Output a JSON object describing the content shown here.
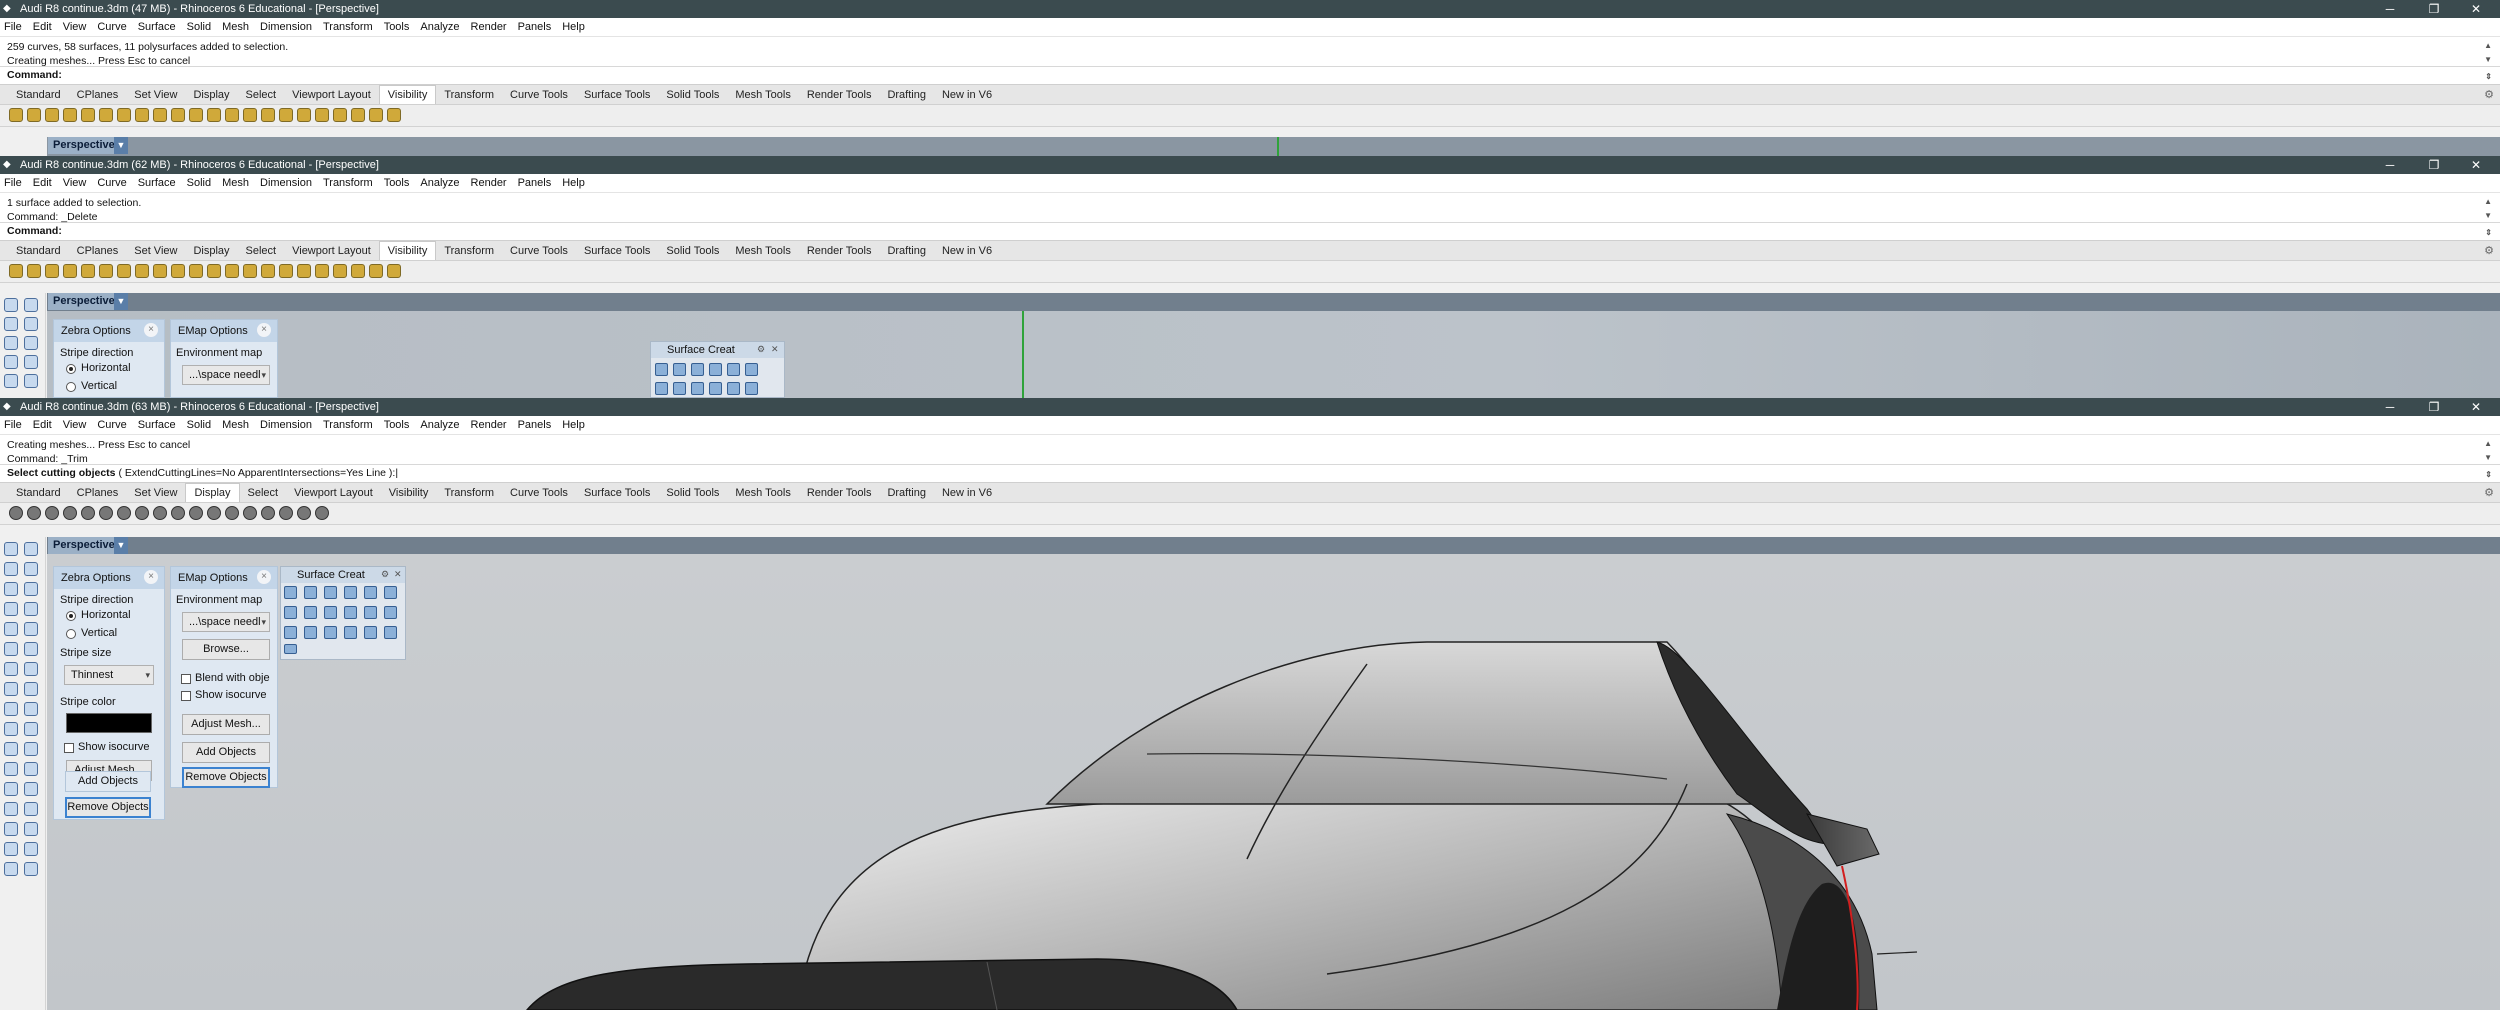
{
  "menu": [
    "File",
    "Edit",
    "View",
    "Curve",
    "Surface",
    "Solid",
    "Mesh",
    "Dimension",
    "Transform",
    "Tools",
    "Analyze",
    "Render",
    "Panels",
    "Help"
  ],
  "tabs": [
    "Standard",
    "CPlanes",
    "Set View",
    "Display",
    "Select",
    "Viewport Layout",
    "Visibility",
    "Transform",
    "Curve Tools",
    "Surface Tools",
    "Solid Tools",
    "Mesh Tools",
    "Render Tools",
    "Drafting",
    "New in V6"
  ],
  "icons": {
    "app": "rhino-icon",
    "minimize": "minimize-icon",
    "maximize": "maximize-icon",
    "close": "close-icon",
    "gear": "gear-icon",
    "dropdown": "chevron-down-icon"
  },
  "colors": {
    "titlebar": "#3b4b4f",
    "viewport_tab": "#9bb0c6",
    "panel": "#dfe8f2",
    "accent": "#3b82d0",
    "curve_red": "#d21f1f",
    "axis_green": "#2fa33a"
  },
  "window1": {
    "title": "Audi R8 continue.3dm (47 MB) - Rhinoceros 6 Educational - [Perspective]",
    "history": [
      "259 curves, 58 surfaces, 11 polysurfaces added to selection.",
      "Creating meshes... Press Esc to cancel"
    ],
    "command_label": "Command:",
    "active_tab": "Visibility",
    "viewport_label": "Perspective"
  },
  "window2": {
    "title": "Audi R8 continue.3dm (62 MB) - Rhinoceros 6 Educational - [Perspective]",
    "history": [
      "1 surface added to selection.",
      "Command: _Delete"
    ],
    "command_label": "Command:",
    "active_tab": "Visibility",
    "viewport_label": "Perspective",
    "zebra_title": "Zebra Options",
    "stripe_direction": "Stripe direction",
    "horizontal": "Horizontal",
    "vertical": "Vertical",
    "emap_title": "EMap Options",
    "environment_map": "Environment map",
    "emap_value": "...\\space needl",
    "surface_panel": "Surface Creat"
  },
  "window3": {
    "title": "Audi R8 continue.3dm (63 MB) - Rhinoceros 6 Educational - [Perspective]",
    "history": [
      "Creating meshes... Press Esc to cancel",
      "Command: _Trim"
    ],
    "command_label": "Select cutting objects",
    "command_options": "( ExtendCuttingLines=No  ApparentIntersections=Yes  Line ):",
    "active_tab": "Display",
    "viewport_label": "Perspective",
    "zebra": {
      "title": "Zebra Options",
      "stripe_direction": "Stripe direction",
      "horizontal": "Horizontal",
      "vertical": "Vertical",
      "stripe_size": "Stripe size",
      "stripe_size_value": "Thinnest",
      "stripe_color": "Stripe color",
      "show_isocurve": "Show isocurve",
      "adjust_mesh": "Adjust Mesh...",
      "add_objects": "Add Objects",
      "remove_objects": "Remove Objects"
    },
    "emap": {
      "title": "EMap Options",
      "environment_map": "Environment map",
      "map_value": "...\\space needl",
      "browse": "Browse...",
      "blend": "Blend with obje",
      "show_isocurve": "Show isocurve",
      "adjust_mesh": "Adjust Mesh...",
      "add_objects": "Add Objects",
      "remove_objects": "Remove Objects"
    },
    "surface_panel": "Surface Creat"
  }
}
